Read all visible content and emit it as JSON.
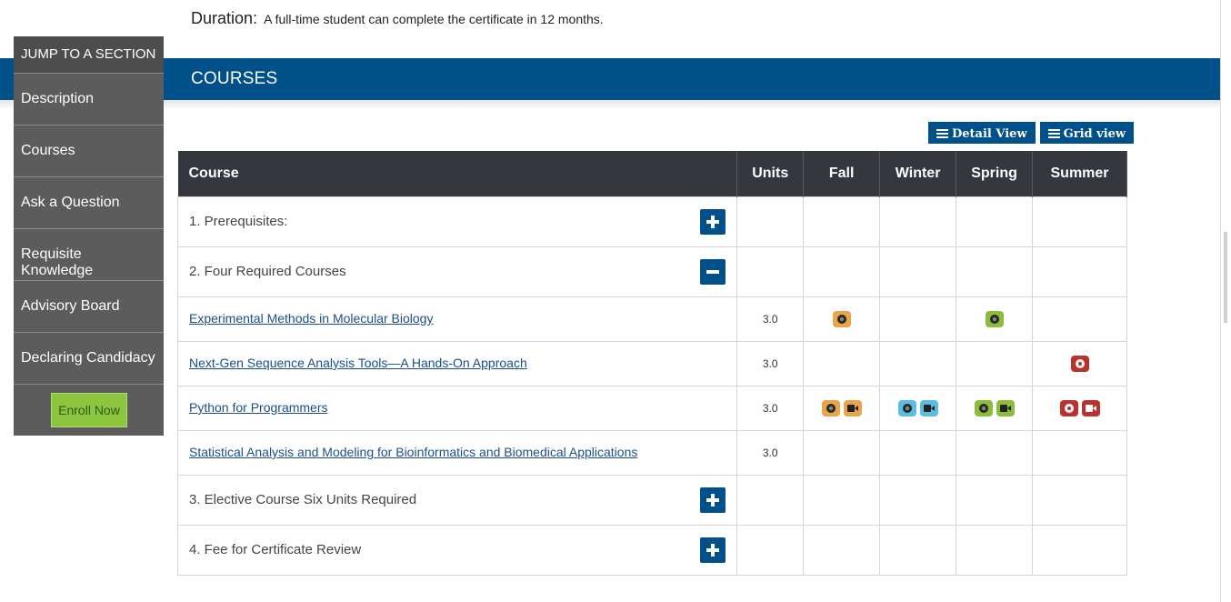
{
  "duration": {
    "label": "Duration:",
    "text": "A full-time student can complete the certificate in 12 months."
  },
  "banner": {
    "title": "COURSES"
  },
  "sidenav": {
    "heading": "JUMP TO A SECTION",
    "items": [
      "Description",
      "Courses",
      "Ask a Question",
      "Requisite Knowledge",
      "Advisory Board",
      "Declaring Candidacy"
    ],
    "enroll_label": "Enroll Now"
  },
  "view_buttons": {
    "detail": "Detail View",
    "grid": "Grid view"
  },
  "table": {
    "headers": [
      "Course",
      "Units",
      "Fall",
      "Winter",
      "Spring",
      "Summer"
    ],
    "groups": [
      {
        "label": "1. Prerequisites:",
        "toggle": "expand"
      },
      {
        "label": "2. Four Required Courses",
        "toggle": "collapse"
      },
      {
        "label": "3. Elective Course Six Units Required",
        "toggle": "expand"
      },
      {
        "label": "4. Fee for Certificate Review",
        "toggle": "expand"
      }
    ],
    "courses": [
      {
        "name": "Experimental Methods in Molecular Biology",
        "units": "3.0",
        "fall": [
          {
            "color": "#e9a54c",
            "icon": "globe-icon"
          }
        ],
        "winter": [],
        "spring": [
          {
            "color": "#8dbb3c",
            "icon": "globe-icon"
          }
        ],
        "summer": []
      },
      {
        "name": "Next-Gen Sequence Analysis Tools—A Hands-On Approach",
        "units": "3.0",
        "fall": [],
        "winter": [],
        "spring": [],
        "summer": [
          {
            "color": "#b8332e",
            "icon": "globe-icon"
          }
        ]
      },
      {
        "name": "Python for Programmers",
        "units": "3.0",
        "fall": [
          {
            "color": "#e9a54c",
            "icon": "globe-icon"
          },
          {
            "color": "#e9a54c",
            "icon": "video-camera-icon"
          }
        ],
        "winter": [
          {
            "color": "#5cbde3",
            "icon": "globe-icon"
          },
          {
            "color": "#5cbde3",
            "icon": "video-camera-icon"
          }
        ],
        "spring": [
          {
            "color": "#8dbb3c",
            "icon": "globe-icon"
          },
          {
            "color": "#8dbb3c",
            "icon": "video-camera-icon"
          }
        ],
        "summer": [
          {
            "color": "#b8332e",
            "icon": "globe-icon"
          },
          {
            "color": "#b8332e",
            "icon": "video-camera-icon"
          }
        ]
      },
      {
        "name": "Statistical Analysis and Modeling for Bioinformatics and Biomedical Applications",
        "units": "3.0",
        "fall": [],
        "winter": [],
        "spring": [],
        "summer": []
      }
    ]
  },
  "colors": {
    "brand_blue": "#00508a",
    "table_header": "#34373e",
    "sidenav_bg": "#5c5c5c",
    "enroll_green": "#8cc63f"
  }
}
